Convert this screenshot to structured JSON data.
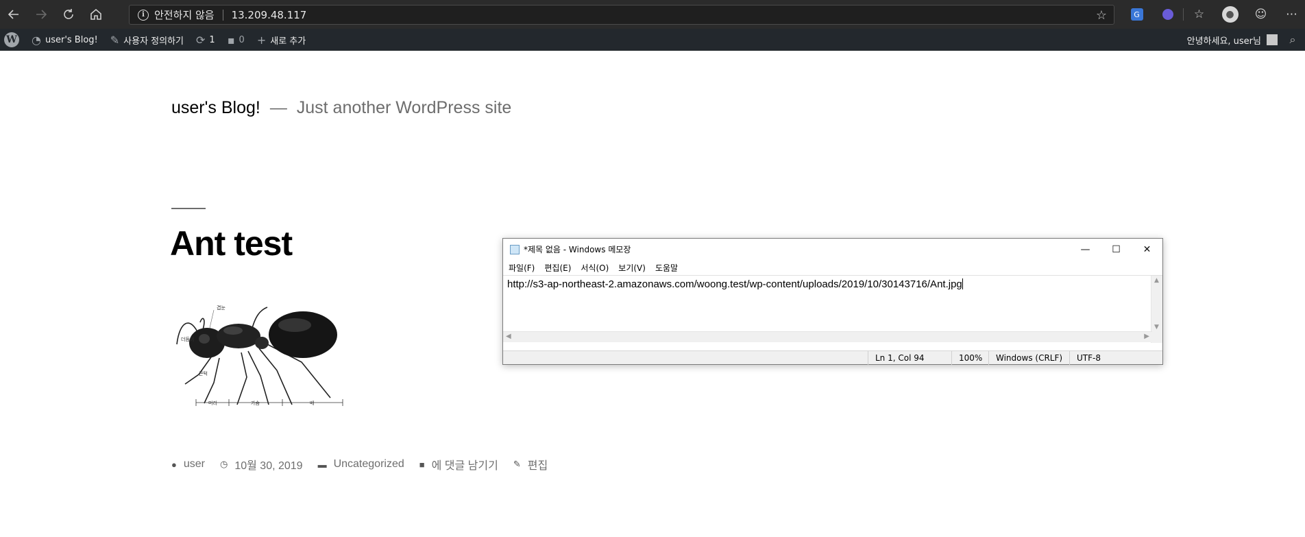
{
  "browser": {
    "security_label": "안전하지 않음",
    "url": "13.209.48.117"
  },
  "admin_bar": {
    "site_name": "user's Blog!",
    "customize": "사용자 정의하기",
    "updates_count": "1",
    "comments_count": "0",
    "new_label": "새로 추가",
    "greeting": "안녕하세요, user님"
  },
  "site": {
    "title": "user's Blog!",
    "separator": "—",
    "description": "Just another WordPress site"
  },
  "post": {
    "title": "Ant test",
    "figure_labels": [
      "겹눈",
      "더듬이",
      "큰턱",
      "머리",
      "가슴",
      "배"
    ],
    "meta": {
      "author": "user",
      "date": "10월 30, 2019",
      "category": "Uncategorized",
      "comment": "에 댓글 남기기",
      "edit": "편집"
    }
  },
  "notepad": {
    "title": "*제목 없음 - Windows 메모장",
    "menu": [
      "파일(F)",
      "편집(E)",
      "서식(O)",
      "보기(V)",
      "도움말"
    ],
    "content": "http://s3-ap-northeast-2.amazonaws.com/woong.test/wp-content/uploads/2019/10/30143716/Ant.jpg",
    "status": {
      "position": "Ln 1, Col 94",
      "zoom": "100%",
      "line_ending": "Windows (CRLF)",
      "encoding": "UTF-8"
    }
  }
}
